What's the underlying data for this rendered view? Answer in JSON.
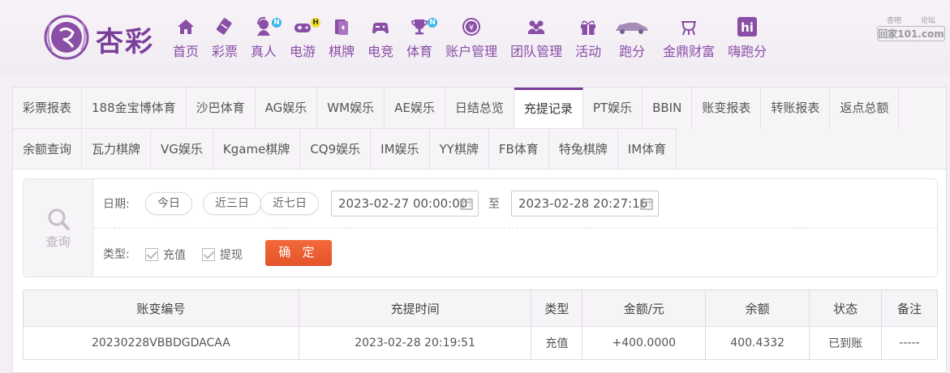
{
  "brand": {
    "logo_text": "杏彩"
  },
  "nav": [
    {
      "label": "首页",
      "icon": "home-icon"
    },
    {
      "label": "彩票",
      "icon": "lottery-ticket-icon"
    },
    {
      "label": "真人",
      "icon": "live-dealer-icon",
      "badge": "N"
    },
    {
      "label": "电游",
      "icon": "gamepad-icon",
      "badge": "H"
    },
    {
      "label": "棋牌",
      "icon": "cards-icon"
    },
    {
      "label": "电竞",
      "icon": "esports-controller-icon"
    },
    {
      "label": "体育",
      "icon": "trophy-icon",
      "badge": "N"
    },
    {
      "label": "账户管理",
      "icon": "yen-coin-icon"
    },
    {
      "label": "团队管理",
      "icon": "team-icon"
    },
    {
      "label": "活动",
      "icon": "gift-icon"
    },
    {
      "label": "跑分",
      "icon": "racing-car-icon"
    },
    {
      "label": "金鼎财富",
      "icon": "tripod-icon"
    },
    {
      "label": "嗨跑分",
      "icon": "hi-logo-icon"
    }
  ],
  "watermark": {
    "top_left": "杏吧",
    "top_right": "论坛",
    "bottom": "回家101.com"
  },
  "tabs_row1": [
    "彩票报表",
    "188金宝博体育",
    "沙巴体育",
    "AG娱乐",
    "WM娱乐",
    "AE娱乐",
    "日结总览",
    "充提记录",
    "PT娱乐",
    "BBIN",
    "账变报表",
    "转账报表",
    "返点总额"
  ],
  "tabs_row2": [
    "余额查询",
    "瓦力棋牌",
    "VG娱乐",
    "Kgame棋牌",
    "CQ9娱乐",
    "IM娱乐",
    "YY棋牌",
    "FB体育",
    "特兔棋牌",
    "IM体育"
  ],
  "active_tab": "充提记录",
  "search": {
    "icon_label": "查询",
    "date_label": "日期:",
    "quick_ranges": [
      "今日",
      "近三日",
      "近七日"
    ],
    "start_date": "2023-02-27 00:00:00",
    "to_label": "至",
    "end_date": "2023-02-28 20:27:16",
    "type_label": "类型:",
    "types": [
      "充值",
      "提现"
    ],
    "confirm_label": "确 定"
  },
  "table": {
    "headers": [
      "账变编号",
      "充提时间",
      "类型",
      "金额/元",
      "余额",
      "状态",
      "备注"
    ],
    "rows": [
      [
        "20230228VBBDGDACAA",
        "2023-02-28 20:19:51",
        "充值",
        "+400.0000",
        "400.4332",
        "已到账",
        "-----"
      ]
    ]
  },
  "colors": {
    "brand_purple": "#7b3f98",
    "confirm_orange": "#ea5b2f",
    "amount_red": "#d9302c",
    "status_green": "#3b9a3b"
  }
}
